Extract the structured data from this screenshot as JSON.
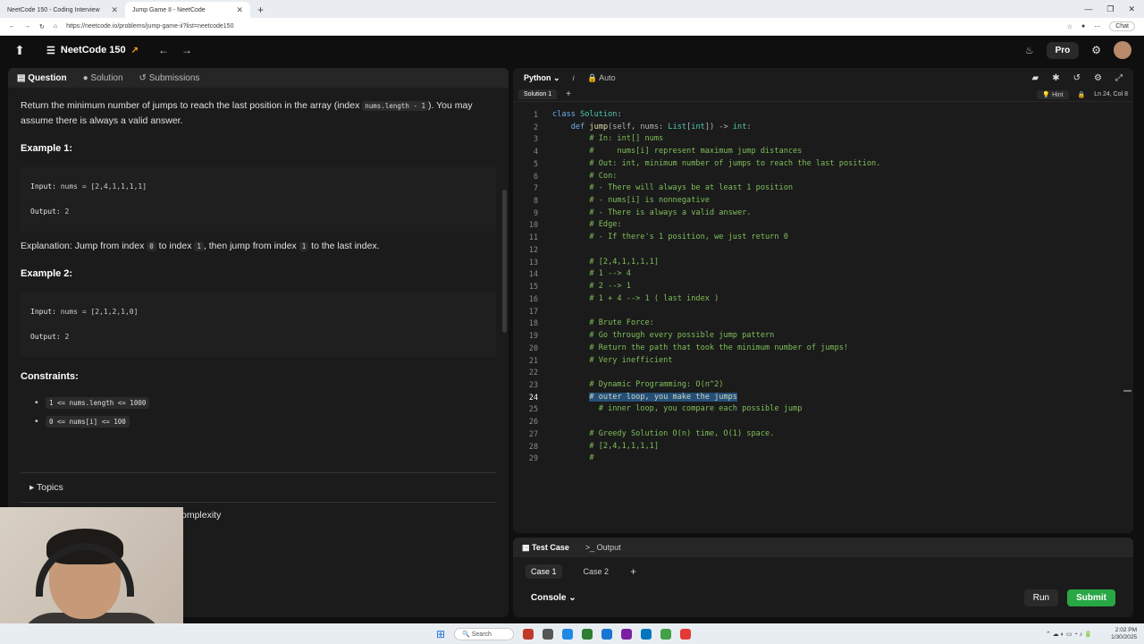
{
  "browser": {
    "tabs": [
      {
        "label": "NeetCode 150 - Coding Interview",
        "active": false
      },
      {
        "label": "Jump Game II - NeetCode",
        "active": true
      }
    ],
    "url": "https://neetcode.io/problems/jump-game-ii?list=neetcode150",
    "chat": "Chat"
  },
  "app": {
    "brand": "NeetCode 150",
    "pro": "Pro"
  },
  "left_tabs": [
    "Question",
    "Solution",
    "Submissions"
  ],
  "question": {
    "intro_a": "Return the minimum number of jumps to reach the last position in the array (index ",
    "intro_code": "nums.length - 1",
    "intro_b": "). You may assume there is always a valid answer.",
    "example1_title": "Example 1:",
    "example1_input_label": "Input:",
    "example1_input": "nums = [2,4,1,1,1,1]",
    "example1_output_label": "Output:",
    "example1_output": "2",
    "explanation_a": "Explanation: Jump from index ",
    "explanation_c1": "0",
    "explanation_b": " to index ",
    "explanation_c2": "1",
    "explanation_c": ", then jump from index ",
    "explanation_c3": "1",
    "explanation_d": " to the last index.",
    "example2_title": "Example 2:",
    "example2_input_label": "Input:",
    "example2_input": "nums = [2,1,2,1,0]",
    "example2_output_label": "Output:",
    "example2_output": "2",
    "constraints_title": "Constraints:",
    "constraints": [
      "1 <= nums.length <= 1000",
      "0 <= nums[i] <= 100"
    ],
    "topics": "Topics",
    "complexity_partial": "omplexity"
  },
  "editor": {
    "language": "Python",
    "mode": "Auto",
    "solution_tab": "Solution 1",
    "hint": "Hint",
    "cursor": "Ln 24, Col 8",
    "current_line": 24
  },
  "bottom": {
    "tabs": [
      "Test Case",
      "Output"
    ],
    "cases": [
      "Case 1",
      "Case 2"
    ],
    "console": "Console",
    "run": "Run",
    "submit": "Submit"
  },
  "taskbar": {
    "search": "Search",
    "time": "2:02 PM",
    "date": "1/30/2025"
  }
}
